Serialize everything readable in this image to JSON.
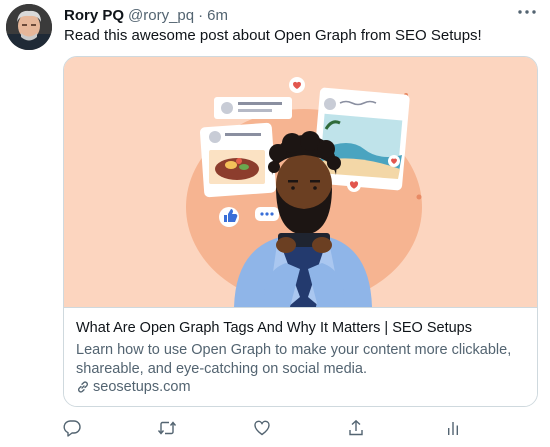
{
  "tweet": {
    "author": {
      "display_name": "Rory PQ",
      "handle": "@rory_pq",
      "separator": "·",
      "time": "6m"
    },
    "text": "Read this awesome post about Open Graph from SEO Setups!",
    "card": {
      "title": "What Are Open Graph Tags And Why It Matters | SEO Setups",
      "description": "Learn how to use Open Graph to make your content more clickable, shareable, and eye-catching on social media.",
      "link": "seosetups.com"
    },
    "actions": [
      "reply-icon",
      "retweet-icon",
      "like-icon",
      "share-icon",
      "analytics-icon"
    ]
  },
  "colors": {
    "text": "#0f1419",
    "muted": "#536471",
    "border": "#cfd9de",
    "card_bg": "#fcd5bf"
  }
}
